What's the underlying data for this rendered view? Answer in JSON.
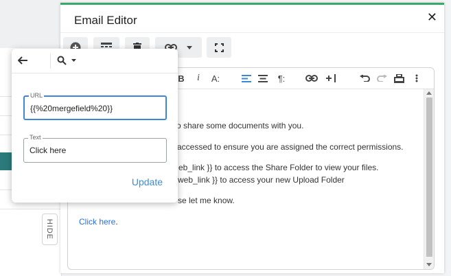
{
  "dialog": {
    "title": "Email Editor",
    "close_icon": "close-icon"
  },
  "toolbar": {
    "buttons": [
      "add-circle-icon",
      "table-icon",
      "trash-icon",
      "link-icon",
      "dropdown-caret-icon",
      "fullscreen-icon"
    ]
  },
  "format_bar": {
    "buttons": [
      "bold-icon",
      "italic-icon",
      "font-size-icon",
      "align-left-icon",
      "align-center-icon",
      "paragraph-icon",
      "link-icon",
      "insert-icon",
      "undo-icon",
      "redo-icon",
      "print-icon",
      "more-vertical-icon"
    ],
    "bold_label": "B",
    "italic_label": "i",
    "font_size_label": "A:",
    "paragraph_label": "¶:"
  },
  "content": {
    "lines": [
      "o share some documents with you.",
      "accessed to ensure you are assigned the correct permissions.",
      "eb_link }} to access the Share Folder to view your files.",
      "web_link }} to access your new Upload Folder",
      "se let me know."
    ],
    "link_line_text": "Click here",
    "link_line_suffix": "."
  },
  "sidebar": {
    "hide_label": "HIDE"
  },
  "popup": {
    "url_legend": "URL",
    "url_value": "{{%20mergefield%20}}",
    "text_legend": "Text",
    "text_value": "Click here",
    "update_label": "Update"
  },
  "colors": {
    "accent_top": "#3aa76d",
    "link_blue": "#2a6fd6",
    "focus_blue": "#3d85d6",
    "teal_band": "#2c7a7b"
  }
}
